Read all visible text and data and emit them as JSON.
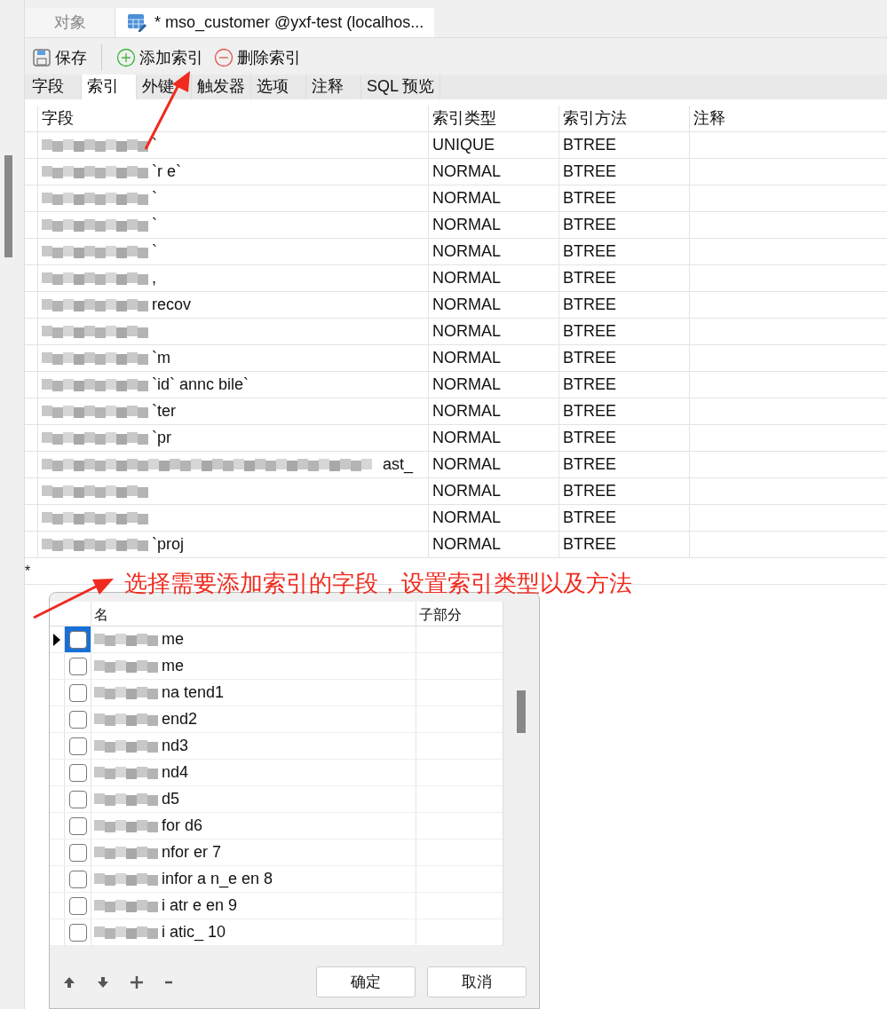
{
  "tabs": [
    {
      "label": "对象",
      "selected": false
    },
    {
      "label": "* mso_customer @yxf-test (localhos...",
      "selected": true
    }
  ],
  "toolbar": [
    {
      "label": "保存",
      "kind": "save"
    },
    {
      "label": "添加索引",
      "kind": "add"
    },
    {
      "label": "删除索引",
      "kind": "remove"
    }
  ],
  "subtabs": [
    {
      "label": "字段",
      "selected": false
    },
    {
      "label": "索引",
      "selected": true
    },
    {
      "label": "外键",
      "selected": false
    },
    {
      "label": "触发器",
      "selected": false
    },
    {
      "label": "选项",
      "selected": false
    },
    {
      "label": "注释",
      "selected": false
    },
    {
      "label": "SQL 预览",
      "selected": false
    }
  ],
  "table": {
    "columns": [
      "字段",
      "索引类型",
      "索引方法",
      "注释"
    ],
    "rows": [
      {
        "field": "`",
        "type": "UNIQUE",
        "method": "BTREE"
      },
      {
        "field": "`r  e`",
        "type": "NORMAL",
        "method": "BTREE"
      },
      {
        "field": "`",
        "type": "NORMAL",
        "method": "BTREE"
      },
      {
        "field": "`",
        "type": "NORMAL",
        "method": "BTREE"
      },
      {
        "field": "`",
        "type": "NORMAL",
        "method": "BTREE"
      },
      {
        "field": ",",
        "type": "NORMAL",
        "method": "BTREE"
      },
      {
        "field": "recov",
        "type": "NORMAL",
        "method": "BTREE"
      },
      {
        "type": "NORMAL",
        "method": "BTREE"
      },
      {
        "field": "`m",
        "type": "NORMAL",
        "method": "BTREE"
      },
      {
        "field": "`id` annc bile`",
        "type": "NORMAL",
        "method": "BTREE"
      },
      {
        "field": "`ter",
        "type": "NORMAL",
        "method": "BTREE"
      },
      {
        "field": "`pr",
        "type": "NORMAL",
        "method": "BTREE"
      },
      {
        "field": "ast_",
        "type": "NORMAL",
        "method": "BTREE"
      },
      {
        "type": "NORMAL",
        "method": "BTREE"
      },
      {
        "type": "NORMAL",
        "method": "BTREE"
      },
      {
        "field": "`proj",
        "type": "NORMAL",
        "method": "BTREE"
      }
    ],
    "new_row_marker": "*"
  },
  "annotation": "选择需要添加索引的字段，设置索引类型以及方法",
  "popup": {
    "columns": [
      "名",
      "子部分"
    ],
    "rows": [
      {
        "name": "me",
        "checked": false,
        "selected": true
      },
      {
        "name": "me",
        "checked": false,
        "selected": false
      },
      {
        "name": "na tend1",
        "checked": false,
        "selected": false
      },
      {
        "name": "end2",
        "checked": false,
        "selected": false
      },
      {
        "name": "nd3",
        "checked": false,
        "selected": false
      },
      {
        "name": "nd4",
        "checked": false,
        "selected": false
      },
      {
        "name": "d5",
        "checked": false,
        "selected": false
      },
      {
        "name": "for d6",
        "checked": false,
        "selected": false
      },
      {
        "name": "nfor er 7",
        "checked": false,
        "selected": false
      },
      {
        "name": "infor a n_e en 8",
        "checked": false,
        "selected": false
      },
      {
        "name": "i atr e en 9",
        "checked": false,
        "selected": false
      },
      {
        "name": "i atic_ 10",
        "checked": false,
        "selected": false
      }
    ],
    "buttons": [
      "确定",
      "取消"
    ]
  }
}
